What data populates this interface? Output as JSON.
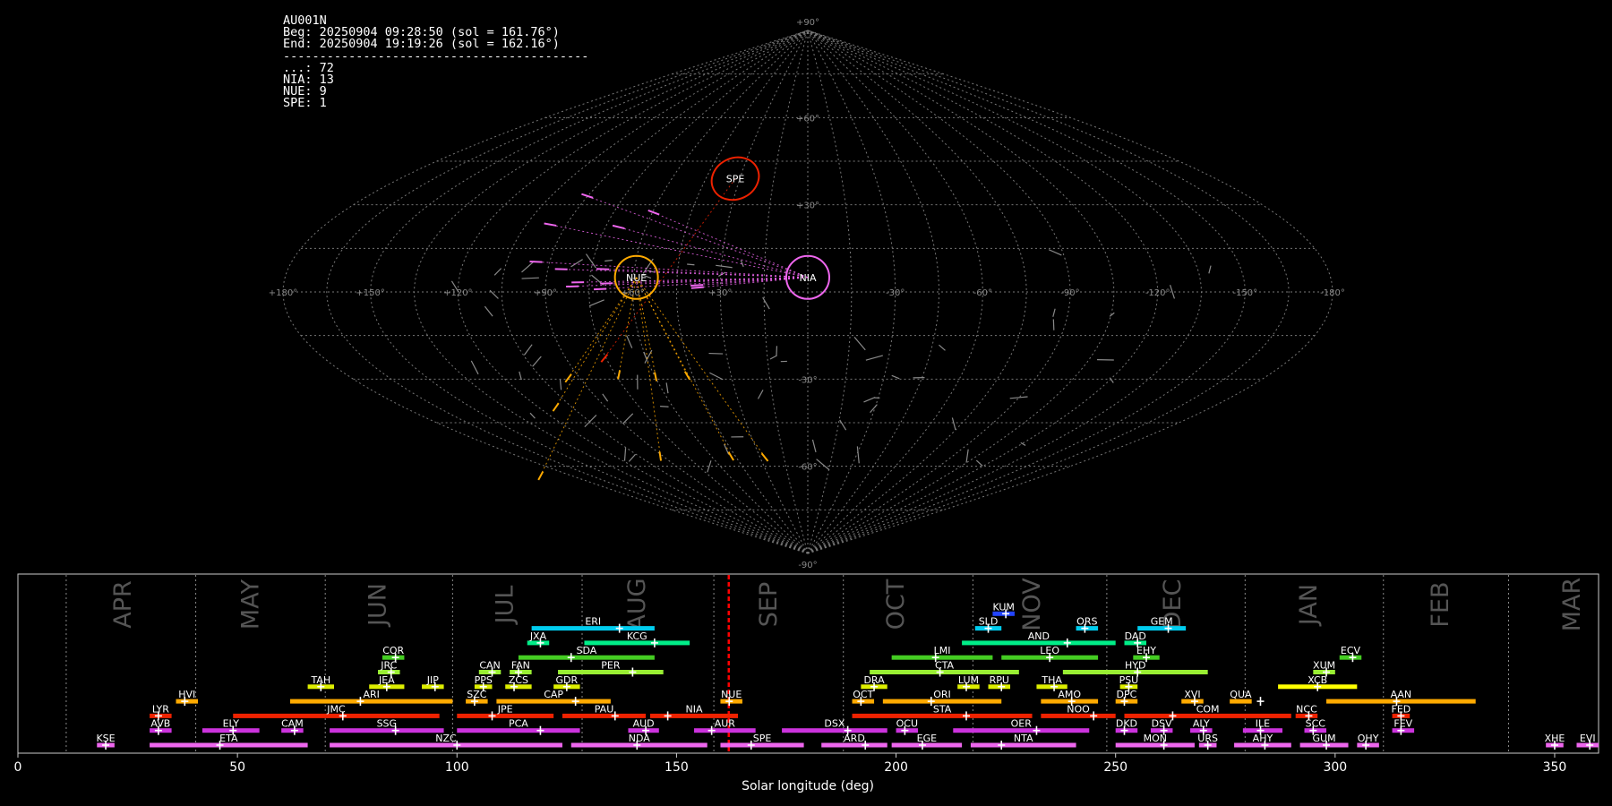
{
  "info": {
    "station": "AU001N",
    "beg": "Beg: 20250904 09:28:50 (sol = 161.76°)",
    "end": "End: 20250904 19:19:26 (sol = 162.16°)",
    "separator": "------------------------------------------",
    "counts": [
      "...: 72",
      "NIA: 13",
      "NUE: 9",
      "SPE: 1"
    ]
  },
  "colors": {
    "background": "#000000",
    "grid": "#777777",
    "text": "#ffffff",
    "frame": "#cccccc",
    "current_sol_line": "#ff0000"
  },
  "sky_map": {
    "projection": "sinusoidal",
    "meridian_labels": [
      "+180°",
      "+150°",
      "+120°",
      "+90°",
      "+60°",
      "+30°",
      "0°",
      "-30°",
      "-60°",
      "-90°",
      "-120°",
      "-150°",
      "-180°"
    ],
    "latitude_labels": [
      "+90°",
      "+60°",
      "+30°",
      "-30°",
      "-60°",
      "-90°"
    ],
    "radiants": [
      {
        "code": "SPE",
        "lon": 32,
        "lat": 39,
        "color": "#ee2200"
      },
      {
        "code": "NUE",
        "lon": 59,
        "lat": 5,
        "color": "#ffaa00"
      },
      {
        "code": "NIA",
        "lon": 0,
        "lat": 5,
        "color": "#ee66ee"
      }
    ]
  },
  "chart_data": {
    "type": "timeline",
    "xlabel": "Solar longitude (deg)",
    "xlim": [
      0,
      360
    ],
    "xticks": [
      0,
      50,
      100,
      150,
      200,
      250,
      300,
      350
    ],
    "current_sol": 161.9,
    "month_boundaries": [
      11,
      40.5,
      70,
      99,
      128.5,
      158.5,
      188,
      217.5,
      248,
      279.5,
      311,
      339.5
    ],
    "months": [
      {
        "label": "APR",
        "sol": 24
      },
      {
        "label": "MAY",
        "sol": 53
      },
      {
        "label": "JUN",
        "sol": 82
      },
      {
        "label": "JUL",
        "sol": 111
      },
      {
        "label": "AUG",
        "sol": 141
      },
      {
        "label": "SEP",
        "sol": 171
      },
      {
        "label": "OCT",
        "sol": 200
      },
      {
        "label": "NOV",
        "sol": 231
      },
      {
        "label": "DEC",
        "sol": 263
      },
      {
        "label": "JAN",
        "sol": 294
      },
      {
        "label": "FEB",
        "sol": 324
      },
      {
        "label": "MAR",
        "sol": 354
      }
    ],
    "showers": [
      {
        "code": "KUM",
        "row": 10,
        "start": 222,
        "end": 227,
        "peak": 225,
        "color": "#2244ff"
      },
      {
        "code": "ERI",
        "row": 9,
        "start": 117,
        "end": 145,
        "peak": 137,
        "color": "#00ccee"
      },
      {
        "code": "SLD",
        "row": 9,
        "start": 218,
        "end": 224,
        "peak": 221,
        "color": "#00ccee"
      },
      {
        "code": "ORS",
        "row": 9,
        "start": 241,
        "end": 246,
        "peak": 243,
        "color": "#00ccee"
      },
      {
        "code": "GEM",
        "row": 9,
        "start": 255,
        "end": 266,
        "peak": 262,
        "color": "#00ccee"
      },
      {
        "code": "JXA",
        "row": 8,
        "start": 116,
        "end": 121,
        "peak": 119,
        "color": "#00ee88"
      },
      {
        "code": "KCG",
        "row": 8,
        "start": 129,
        "end": 153,
        "peak": 145,
        "color": "#00ee88"
      },
      {
        "code": "AND",
        "row": 8,
        "start": 215,
        "end": 250,
        "peak": 239,
        "color": "#00ee88"
      },
      {
        "code": "DAD",
        "row": 8,
        "start": 252,
        "end": 257,
        "peak": 255,
        "color": "#00ee88"
      },
      {
        "code": "COR",
        "row": 7,
        "start": 83,
        "end": 88,
        "peak": 86,
        "color": "#44cc22"
      },
      {
        "code": "SDA",
        "row": 7,
        "start": 114,
        "end": 145,
        "peak": 126,
        "color": "#44cc22"
      },
      {
        "code": "LMI",
        "row": 7,
        "start": 199,
        "end": 222,
        "peak": 209,
        "color": "#44cc22"
      },
      {
        "code": "LEO",
        "row": 7,
        "start": 224,
        "end": 246,
        "peak": 235,
        "color": "#44cc22"
      },
      {
        "code": "EHY",
        "row": 7,
        "start": 254,
        "end": 260,
        "peak": 257,
        "color": "#44cc22"
      },
      {
        "code": "ECV",
        "row": 7,
        "start": 301,
        "end": 306,
        "peak": 304,
        "color": "#44cc22"
      },
      {
        "code": "JRC",
        "row": 6,
        "start": 82,
        "end": 87,
        "peak": 85,
        "color": "#99ee33"
      },
      {
        "code": "CAN",
        "row": 6,
        "start": 105,
        "end": 110,
        "peak": 108,
        "color": "#99ee33"
      },
      {
        "code": "FAN",
        "row": 6,
        "start": 112,
        "end": 117,
        "peak": 114,
        "color": "#99ee33"
      },
      {
        "code": "PER",
        "row": 6,
        "start": 123,
        "end": 147,
        "peak": 140,
        "color": "#99ee33"
      },
      {
        "code": "CTA",
        "row": 6,
        "start": 194,
        "end": 228,
        "peak": 210,
        "color": "#99ee33"
      },
      {
        "code": "HYD",
        "row": 6,
        "start": 238,
        "end": 271,
        "peak": 255,
        "color": "#99ee33"
      },
      {
        "code": "XUM",
        "row": 6,
        "start": 295,
        "end": 300,
        "peak": 298,
        "color": "#99ee33"
      },
      {
        "code": "TAH",
        "row": 5,
        "start": 66,
        "end": 72,
        "peak": 69,
        "color": "#ddee00"
      },
      {
        "code": "JEA",
        "row": 5,
        "start": 80,
        "end": 88,
        "peak": 84,
        "color": "#ddee00"
      },
      {
        "code": "JIP",
        "row": 5,
        "start": 92,
        "end": 97,
        "peak": 95,
        "color": "#ddee00"
      },
      {
        "code": "PPS",
        "row": 5,
        "start": 104,
        "end": 108,
        "peak": 106,
        "color": "#ddee00"
      },
      {
        "code": "ZCS",
        "row": 5,
        "start": 111,
        "end": 117,
        "peak": 113,
        "color": "#ddee00"
      },
      {
        "code": "GDR",
        "row": 5,
        "start": 122,
        "end": 128,
        "peak": 125,
        "color": "#ddee00"
      },
      {
        "code": "DRA",
        "row": 5,
        "start": 192,
        "end": 198,
        "peak": 195,
        "color": "#ddee00"
      },
      {
        "code": "LUM",
        "row": 5,
        "start": 214,
        "end": 219,
        "peak": 216,
        "color": "#ddee00"
      },
      {
        "code": "RPU",
        "row": 5,
        "start": 221,
        "end": 226,
        "peak": 224,
        "color": "#ddee00"
      },
      {
        "code": "THA",
        "row": 5,
        "start": 232,
        "end": 239,
        "peak": 236,
        "color": "#ddee00"
      },
      {
        "code": "PSU",
        "row": 5,
        "start": 251,
        "end": 255,
        "peak": 253,
        "color": "#ddee00"
      },
      {
        "code": "XCB",
        "row": 5,
        "start": 287,
        "end": 305,
        "peak": 296,
        "color": "#ffff00"
      },
      {
        "code": "HVI",
        "row": 4,
        "start": 36,
        "end": 41,
        "peak": 38,
        "color": "#ffaa00"
      },
      {
        "code": "ARI",
        "row": 4,
        "start": 62,
        "end": 99,
        "peak": 78,
        "color": "#ffaa00"
      },
      {
        "code": "SZC",
        "row": 4,
        "start": 102,
        "end": 107,
        "peak": 104,
        "color": "#ffaa00"
      },
      {
        "code": "CAP",
        "row": 4,
        "start": 109,
        "end": 135,
        "peak": 127,
        "color": "#ffaa00"
      },
      {
        "code": "NUE",
        "row": 4,
        "start": 160,
        "end": 165,
        "peak": 162,
        "color": "#ffaa00"
      },
      {
        "code": "OCT",
        "row": 4,
        "start": 190,
        "end": 195,
        "peak": 192,
        "color": "#ffaa00"
      },
      {
        "code": "ORI",
        "row": 4,
        "start": 197,
        "end": 224,
        "peak": 208,
        "color": "#ffaa00"
      },
      {
        "code": "AMO",
        "row": 4,
        "start": 233,
        "end": 246,
        "peak": 240,
        "color": "#ffaa00"
      },
      {
        "code": "DPC",
        "row": 4,
        "start": 250,
        "end": 255,
        "peak": 252,
        "color": "#ffaa00"
      },
      {
        "code": "XVI",
        "row": 4,
        "start": 265,
        "end": 270,
        "peak": 268,
        "color": "#ffaa00"
      },
      {
        "code": "QUA",
        "row": 4,
        "start": 276,
        "end": 281,
        "peak": 283,
        "color": "#ffaa00"
      },
      {
        "code": "AAN",
        "row": 4,
        "start": 298,
        "end": 332,
        "peak": 314,
        "color": "#ffaa00"
      },
      {
        "code": "LYR",
        "row": 3,
        "start": 30,
        "end": 35,
        "peak": 32,
        "color": "#ee2200"
      },
      {
        "code": "JMC",
        "row": 3,
        "start": 49,
        "end": 96,
        "peak": 74,
        "color": "#ee2200"
      },
      {
        "code": "JPE",
        "row": 3,
        "start": 100,
        "end": 122,
        "peak": 108,
        "color": "#ee2200"
      },
      {
        "code": "PAU",
        "row": 3,
        "start": 124,
        "end": 143,
        "peak": 136,
        "color": "#ee2200"
      },
      {
        "code": "NIA",
        "row": 3,
        "start": 144,
        "end": 164,
        "peak": 148,
        "color": "#ee2200"
      },
      {
        "code": "STA",
        "row": 3,
        "start": 190,
        "end": 231,
        "peak": 216,
        "color": "#ee2200"
      },
      {
        "code": "NOO",
        "row": 3,
        "start": 233,
        "end": 250,
        "peak": 245,
        "color": "#ee2200"
      },
      {
        "code": "COM",
        "row": 3,
        "start": 252,
        "end": 290,
        "peak": 263,
        "color": "#ee2200"
      },
      {
        "code": "NCC",
        "row": 3,
        "start": 291,
        "end": 296,
        "peak": 294,
        "color": "#ee2200"
      },
      {
        "code": "FED",
        "row": 3,
        "start": 313,
        "end": 317,
        "peak": 315,
        "color": "#ee2200"
      },
      {
        "code": "AVB",
        "row": 2,
        "start": 30,
        "end": 35,
        "peak": 32,
        "color": "#cc33dd"
      },
      {
        "code": "ELY",
        "row": 2,
        "start": 42,
        "end": 55,
        "peak": 49,
        "color": "#cc33dd"
      },
      {
        "code": "CAM",
        "row": 2,
        "start": 60,
        "end": 65,
        "peak": 63,
        "color": "#cc33dd"
      },
      {
        "code": "SSG",
        "row": 2,
        "start": 71,
        "end": 97,
        "peak": 86,
        "color": "#cc33dd"
      },
      {
        "code": "PCA",
        "row": 2,
        "start": 100,
        "end": 128,
        "peak": 119,
        "color": "#cc33dd"
      },
      {
        "code": "AUD",
        "row": 2,
        "start": 139,
        "end": 146,
        "peak": 143,
        "color": "#cc33dd"
      },
      {
        "code": "AUR",
        "row": 2,
        "start": 154,
        "end": 168,
        "peak": 158,
        "color": "#cc33dd"
      },
      {
        "code": "DSX",
        "row": 2,
        "start": 174,
        "end": 198,
        "peak": 189,
        "color": "#cc33dd"
      },
      {
        "code": "OCU",
        "row": 2,
        "start": 200,
        "end": 205,
        "peak": 202,
        "color": "#cc33dd"
      },
      {
        "code": "OER",
        "row": 2,
        "start": 213,
        "end": 244,
        "peak": 232,
        "color": "#cc33dd"
      },
      {
        "code": "DKD",
        "row": 2,
        "start": 250,
        "end": 255,
        "peak": 252,
        "color": "#cc33dd"
      },
      {
        "code": "DSV",
        "row": 2,
        "start": 258,
        "end": 263,
        "peak": 261,
        "color": "#cc33dd"
      },
      {
        "code": "ALY",
        "row": 2,
        "start": 267,
        "end": 272,
        "peak": 270,
        "color": "#cc33dd"
      },
      {
        "code": "ILE",
        "row": 2,
        "start": 279,
        "end": 288,
        "peak": 283,
        "color": "#cc33dd"
      },
      {
        "code": "SCC",
        "row": 2,
        "start": 293,
        "end": 298,
        "peak": 295,
        "color": "#cc33dd"
      },
      {
        "code": "FEV",
        "row": 2,
        "start": 313,
        "end": 318,
        "peak": 315,
        "color": "#cc33dd"
      },
      {
        "code": "KSE",
        "row": 1,
        "start": 18,
        "end": 22,
        "peak": 20,
        "color": "#ee66ee"
      },
      {
        "code": "ETA",
        "row": 1,
        "start": 30,
        "end": 66,
        "peak": 46,
        "color": "#ee66ee"
      },
      {
        "code": "NZC",
        "row": 1,
        "start": 71,
        "end": 124,
        "peak": 100,
        "color": "#ee66ee"
      },
      {
        "code": "NDA",
        "row": 1,
        "start": 126,
        "end": 157,
        "peak": 141,
        "color": "#ee66ee"
      },
      {
        "code": "SPE",
        "row": 1,
        "start": 160,
        "end": 179,
        "peak": 167,
        "color": "#ee66ee"
      },
      {
        "code": "ARD",
        "row": 1,
        "start": 183,
        "end": 198,
        "peak": 193,
        "color": "#ee66ee"
      },
      {
        "code": "EGE",
        "row": 1,
        "start": 199,
        "end": 215,
        "peak": 206,
        "color": "#ee66ee"
      },
      {
        "code": "NTA",
        "row": 1,
        "start": 217,
        "end": 241,
        "peak": 224,
        "color": "#ee66ee"
      },
      {
        "code": "MON",
        "row": 1,
        "start": 250,
        "end": 268,
        "peak": 261,
        "color": "#ee66ee"
      },
      {
        "code": "URS",
        "row": 1,
        "start": 269,
        "end": 273,
        "peak": 271,
        "color": "#ee66ee"
      },
      {
        "code": "AHY",
        "row": 1,
        "start": 277,
        "end": 290,
        "peak": 284,
        "color": "#ee66ee"
      },
      {
        "code": "GUM",
        "row": 1,
        "start": 292,
        "end": 303,
        "peak": 298,
        "color": "#ee66ee"
      },
      {
        "code": "OHY",
        "row": 1,
        "start": 305,
        "end": 310,
        "peak": 307,
        "color": "#ee66ee"
      },
      {
        "code": "XHE",
        "row": 1,
        "start": 348,
        "end": 352,
        "peak": 350,
        "color": "#ee66ee"
      },
      {
        "code": "EVI",
        "row": 1,
        "start": 355,
        "end": 360,
        "peak": 358,
        "color": "#ee66ee"
      }
    ]
  }
}
